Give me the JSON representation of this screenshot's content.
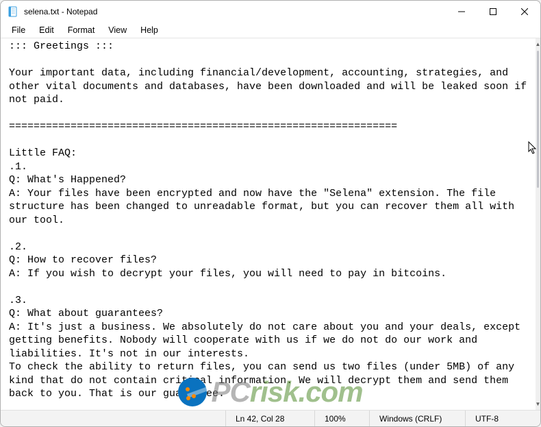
{
  "window": {
    "title": "selena.txt - Notepad",
    "icon": "notepad-icon"
  },
  "menu": {
    "file": "File",
    "edit": "Edit",
    "format": "Format",
    "view": "View",
    "help": "Help"
  },
  "document": {
    "text": "::: Greetings :::\n\nYour important data, including financial/development, accounting, strategies, and other vital documents and databases, have been downloaded and will be leaked soon if not paid.\n\n===============================================================\n\nLittle FAQ:\n.1.\nQ: What's Happened?\nA: Your files have been encrypted and now have the \"Selena\" extension. The file structure has been changed to unreadable format, but you can recover them all with our tool.\n\n.2.\nQ: How to recover files?\nA: If you wish to decrypt your files, you will need to pay in bitcoins.\n\n.3.\nQ: What about guarantees?\nA: It's just a business. We absolutely do not care about you and your deals, except getting benefits. Nobody will cooperate with us if we do not do our work and liabilities. It's not in our interests.\nTo check the ability to return files, you can send us two files (under 5MB) of any kind that do not contain critical information. We will decrypt them and send them back to you. That is our guarantee."
  },
  "status": {
    "position": "Ln 42, Col 28",
    "zoom": "100%",
    "eol": "Windows (CRLF)",
    "encoding": "UTF-8"
  },
  "watermark": {
    "text_prefix": "PC",
    "text_suffix": "risk.com"
  }
}
